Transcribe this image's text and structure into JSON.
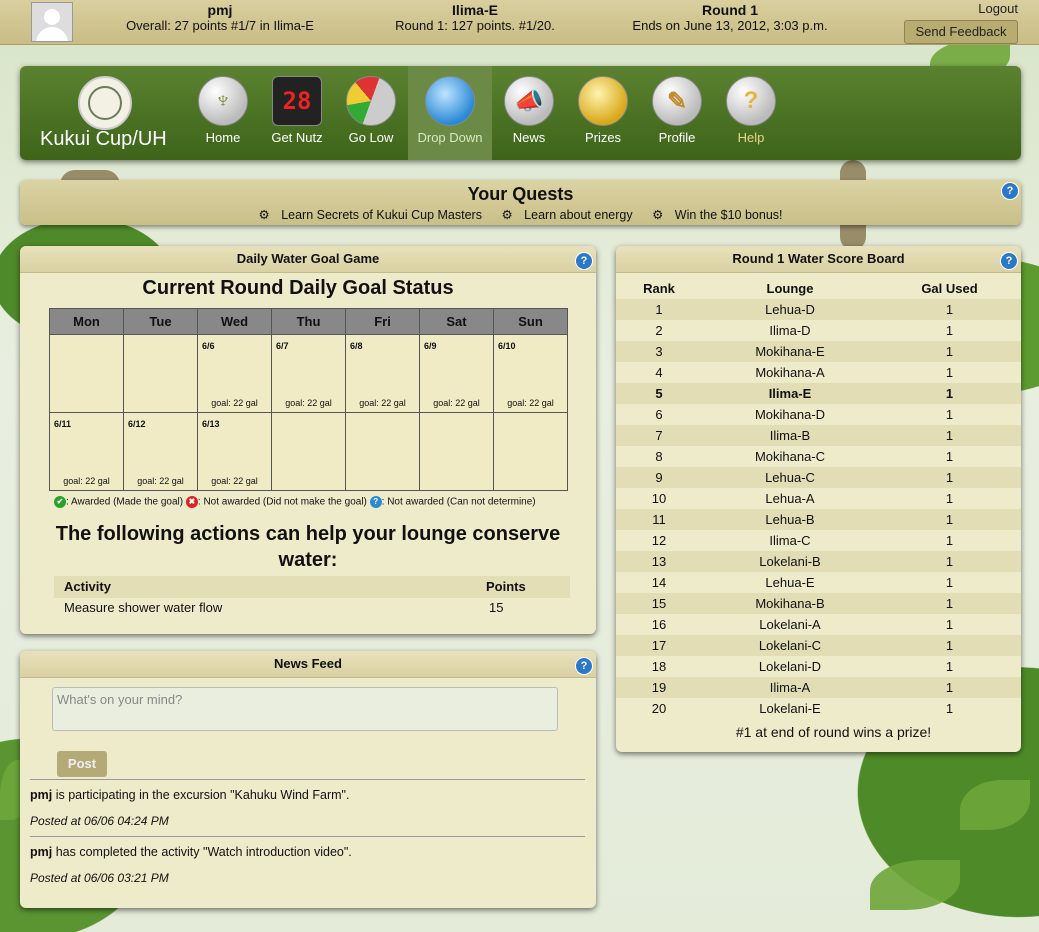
{
  "topbar": {
    "user": "pmj",
    "overall": "Overall: 27 points #1/7 in Ilima-E",
    "lounge": "Ilima-E",
    "round_points": "Round 1: 127 points. #1/20.",
    "round": "Round 1",
    "ends": "Ends on June 13, 2012, 3:03 p.m.",
    "logout": "Logout",
    "feedback": "Send Feedback"
  },
  "nav": {
    "brand": "Kukui Cup/UH",
    "items": [
      {
        "label": "Home",
        "icon": "trophy-icon"
      },
      {
        "label": "Get Nutz",
        "icon": "scoreboard-icon"
      },
      {
        "label": "Go Low",
        "icon": "gauge-icon"
      },
      {
        "label": "Drop Down",
        "icon": "water-drop-icon"
      },
      {
        "label": "News",
        "icon": "megaphone-icon"
      },
      {
        "label": "Prizes",
        "icon": "medal-icon"
      },
      {
        "label": "Profile",
        "icon": "profile-icon"
      },
      {
        "label": "Help",
        "icon": "question-icon"
      }
    ]
  },
  "quests": {
    "title": "Your Quests",
    "items": [
      "Learn Secrets of Kukui Cup Masters",
      "Learn about energy",
      "Win the $10 bonus!"
    ]
  },
  "water_game": {
    "panel_title": "Daily Water Goal Game",
    "title": "Current Round Daily Goal Status",
    "days": [
      "Mon",
      "Tue",
      "Wed",
      "Thu",
      "Fri",
      "Sat",
      "Sun"
    ],
    "week1": [
      {
        "date": "",
        "goal": ""
      },
      {
        "date": "",
        "goal": ""
      },
      {
        "date": "6/6",
        "goal": "goal: 22 gal"
      },
      {
        "date": "6/7",
        "goal": "goal: 22 gal"
      },
      {
        "date": "6/8",
        "goal": "goal: 22 gal"
      },
      {
        "date": "6/9",
        "goal": "goal: 22 gal"
      },
      {
        "date": "6/10",
        "goal": "goal: 22 gal"
      }
    ],
    "week2": [
      {
        "date": "6/11",
        "goal": "goal: 22 gal"
      },
      {
        "date": "6/12",
        "goal": "goal: 22 gal"
      },
      {
        "date": "6/13",
        "goal": "goal: 22 gal"
      },
      {
        "date": "",
        "goal": ""
      },
      {
        "date": "",
        "goal": ""
      },
      {
        "date": "",
        "goal": ""
      },
      {
        "date": "",
        "goal": ""
      }
    ],
    "legend": {
      "awarded": ": Awarded (Made the goal)",
      "not_awarded": ": Not awarded (Did not make the goal)",
      "undetermined": ": Not awarded (Can not determine)"
    },
    "actions_title": "The following actions can help your lounge conserve water:",
    "actions_header": {
      "activity": "Activity",
      "points": "Points"
    },
    "actions": [
      {
        "activity": "Measure shower water flow",
        "points": "15"
      }
    ]
  },
  "scoreboard": {
    "title": "Round 1 Water Score Board",
    "headers": {
      "rank": "Rank",
      "lounge": "Lounge",
      "gal": "Gal Used"
    },
    "rows": [
      {
        "rank": "1",
        "lounge": "Lehua-D",
        "gal": "1"
      },
      {
        "rank": "2",
        "lounge": "Ilima-D",
        "gal": "1"
      },
      {
        "rank": "3",
        "lounge": "Mokihana-E",
        "gal": "1"
      },
      {
        "rank": "4",
        "lounge": "Mokihana-A",
        "gal": "1"
      },
      {
        "rank": "5",
        "lounge": "Ilima-E",
        "gal": "1"
      },
      {
        "rank": "6",
        "lounge": "Mokihana-D",
        "gal": "1"
      },
      {
        "rank": "7",
        "lounge": "Ilima-B",
        "gal": "1"
      },
      {
        "rank": "8",
        "lounge": "Mokihana-C",
        "gal": "1"
      },
      {
        "rank": "9",
        "lounge": "Lehua-C",
        "gal": "1"
      },
      {
        "rank": "10",
        "lounge": "Lehua-A",
        "gal": "1"
      },
      {
        "rank": "11",
        "lounge": "Lehua-B",
        "gal": "1"
      },
      {
        "rank": "12",
        "lounge": "Ilima-C",
        "gal": "1"
      },
      {
        "rank": "13",
        "lounge": "Lokelani-B",
        "gal": "1"
      },
      {
        "rank": "14",
        "lounge": "Lehua-E",
        "gal": "1"
      },
      {
        "rank": "15",
        "lounge": "Mokihana-B",
        "gal": "1"
      },
      {
        "rank": "16",
        "lounge": "Lokelani-A",
        "gal": "1"
      },
      {
        "rank": "17",
        "lounge": "Lokelani-C",
        "gal": "1"
      },
      {
        "rank": "18",
        "lounge": "Lokelani-D",
        "gal": "1"
      },
      {
        "rank": "19",
        "lounge": "Ilima-A",
        "gal": "1"
      },
      {
        "rank": "20",
        "lounge": "Lokelani-E",
        "gal": "1"
      }
    ],
    "footer": "#1 at end of round wins a prize!"
  },
  "newsfeed": {
    "title": "News Feed",
    "placeholder": "What's on your mind?",
    "post": "Post",
    "items": [
      {
        "user": "pmj",
        "text": " is participating in the excursion \"Kahuku Wind Farm\".",
        "time": "Posted at 06/06 04:24 PM"
      },
      {
        "user": "pmj",
        "text": " has completed the activity \"Watch introduction video\".",
        "time": "Posted at 06/06 03:21 PM"
      }
    ]
  },
  "colors": {
    "accent_green": "#4a7124",
    "panel": "#eeebcb",
    "help_blue": "#2a78c8"
  }
}
